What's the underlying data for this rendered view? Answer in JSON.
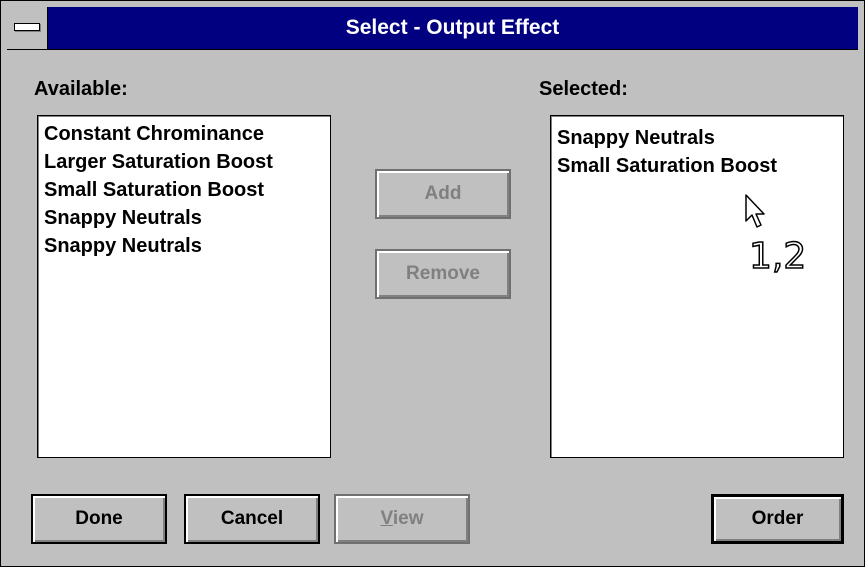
{
  "window": {
    "title": "Select - Output Effect",
    "system_menu_icon": "minus-bar-icon"
  },
  "available": {
    "label": "Available:",
    "items": [
      "Constant Chrominance",
      "Larger Saturation Boost",
      "Small Saturation Boost",
      "Snappy Neutrals",
      "Snappy Neutrals"
    ]
  },
  "selected": {
    "label": "Selected:",
    "items": [
      "Snappy Neutrals",
      "Small Saturation Boost"
    ]
  },
  "buttons": {
    "add": "Add",
    "remove": "Remove",
    "done": "Done",
    "cancel": "Cancel",
    "view_mnemonic": "V",
    "view_rest": "iew",
    "order": "Order"
  },
  "overlay": {
    "cursor_icon": "arrow-cursor-icon",
    "readout": "1,2"
  },
  "colors": {
    "titlebar": "#000080",
    "face": "#c0c0c0",
    "disabled_text": "#808080"
  }
}
